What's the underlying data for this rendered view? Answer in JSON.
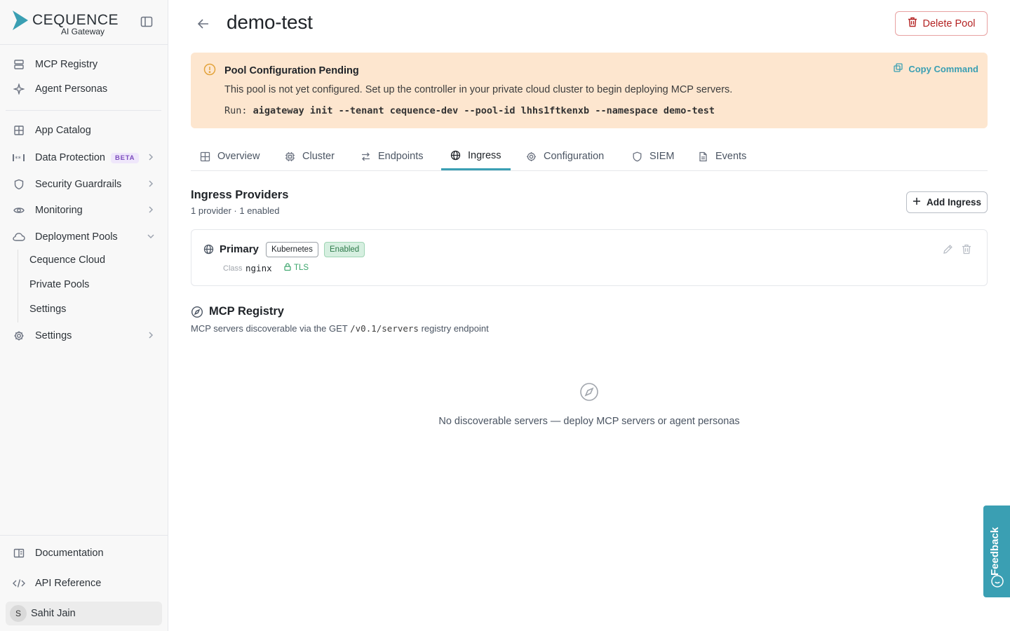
{
  "brand": {
    "name": "CEQUENCE",
    "subtitle": "AI Gateway",
    "accent": "#3a9fb3"
  },
  "sidebar": {
    "items_top": [
      {
        "label": "MCP Registry",
        "icon": "server-stack-icon"
      },
      {
        "label": "Agent Personas",
        "icon": "sparkle-icon"
      }
    ],
    "items_main": [
      {
        "label": "App Catalog",
        "icon": "grid-icon"
      },
      {
        "label": "Data Protection",
        "icon": "masked-data-icon",
        "badge": "BETA"
      },
      {
        "label": "Security Guardrails",
        "icon": "shield-icon"
      },
      {
        "label": "Monitoring",
        "icon": "eye-icon"
      },
      {
        "label": "Deployment Pools",
        "icon": "cloud-icon",
        "expanded": true
      }
    ],
    "sub_items": [
      "Cequence Cloud",
      "Private Pools",
      "Settings"
    ],
    "settings": {
      "label": "Settings",
      "icon": "gear-icon"
    },
    "bottom": [
      {
        "label": "Documentation",
        "icon": "book-icon"
      },
      {
        "label": "API Reference",
        "icon": "code-icon"
      }
    ],
    "user": {
      "initial": "S",
      "name": "Sahit Jain"
    }
  },
  "header": {
    "title": "demo-test",
    "delete_label": "Delete Pool"
  },
  "alert": {
    "title": "Pool Configuration Pending",
    "body": "This pool is not yet configured. Set up the controller in your private cloud cluster to begin deploying MCP servers.",
    "run_prefix": "Run:",
    "command": "aigateway init --tenant cequence-dev --pool-id lhhs1ftkenxb --namespace demo-test",
    "copy_label": "Copy Command",
    "bg_color": "#fde6cf"
  },
  "tabs": [
    {
      "label": "Overview",
      "icon": "grid-icon"
    },
    {
      "label": "Cluster",
      "icon": "chip-icon"
    },
    {
      "label": "Endpoints",
      "icon": "arrows-icon"
    },
    {
      "label": "Ingress",
      "icon": "globe-icon",
      "active": true
    },
    {
      "label": "Configuration",
      "icon": "gear-icon"
    },
    {
      "label": "SIEM",
      "icon": "shield-icon"
    },
    {
      "label": "Events",
      "icon": "document-icon"
    }
  ],
  "ingress": {
    "title": "Ingress Providers",
    "subtitle": "1 provider · 1 enabled",
    "add_label": "Add Ingress",
    "providers": [
      {
        "name": "Primary",
        "type_tag": "Kubernetes",
        "status_tag": "Enabled",
        "class_label": "Class",
        "class_value": "nginx",
        "tls_label": "TLS"
      }
    ]
  },
  "registry": {
    "title": "MCP Registry",
    "subtitle_prefix": "MCP servers discoverable via the GET",
    "endpoint": "/v0.1/servers",
    "subtitle_suffix": "registry endpoint",
    "empty_text": "No discoverable servers — deploy MCP servers or agent personas"
  },
  "feedback": {
    "label": "Feedback"
  }
}
